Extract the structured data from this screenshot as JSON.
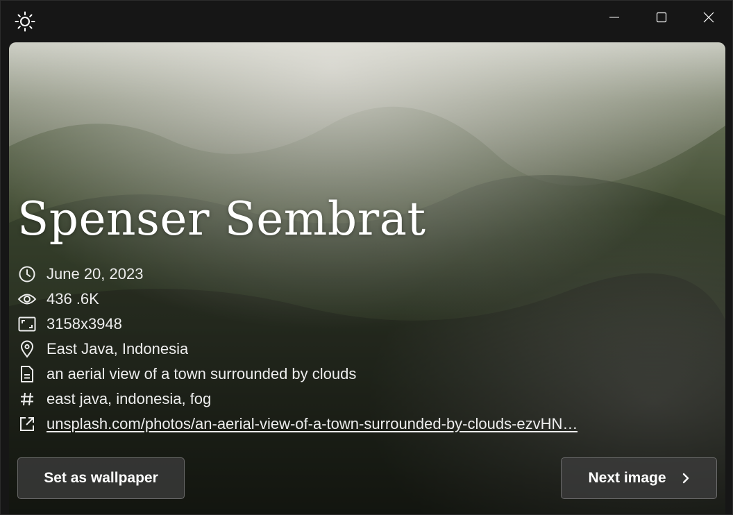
{
  "window": {
    "app_icon": "sun-icon",
    "controls": [
      "minimize-icon",
      "maximize-icon",
      "close-icon"
    ]
  },
  "photo": {
    "author": "Spenser Sembrat",
    "date": "June 20, 2023",
    "views": "436 .6K",
    "resolution": "3158x3948",
    "location": "East Java, Indonesia",
    "description": "an aerial view of a town surrounded by clouds",
    "tags": "east java, indonesia, fog",
    "link": "unsplash.com/photos/an-aerial-view-of-a-town-surrounded-by-clouds-ezvHN…"
  },
  "icons": {
    "date": "clock-icon",
    "views": "eye-icon",
    "resolution": "aspect-ratio-icon",
    "location": "location-pin-icon",
    "description": "document-icon",
    "tags": "hashtag-icon",
    "link": "open-external-icon",
    "next": "chevron-right-icon"
  },
  "actions": {
    "set_wallpaper": "Set as wallpaper",
    "next_image": "Next image"
  },
  "colors": {
    "window_bg": "#161616",
    "text": "#ededed",
    "button_bg": "#3c3c3c",
    "button_border": "#6a6a6a"
  }
}
